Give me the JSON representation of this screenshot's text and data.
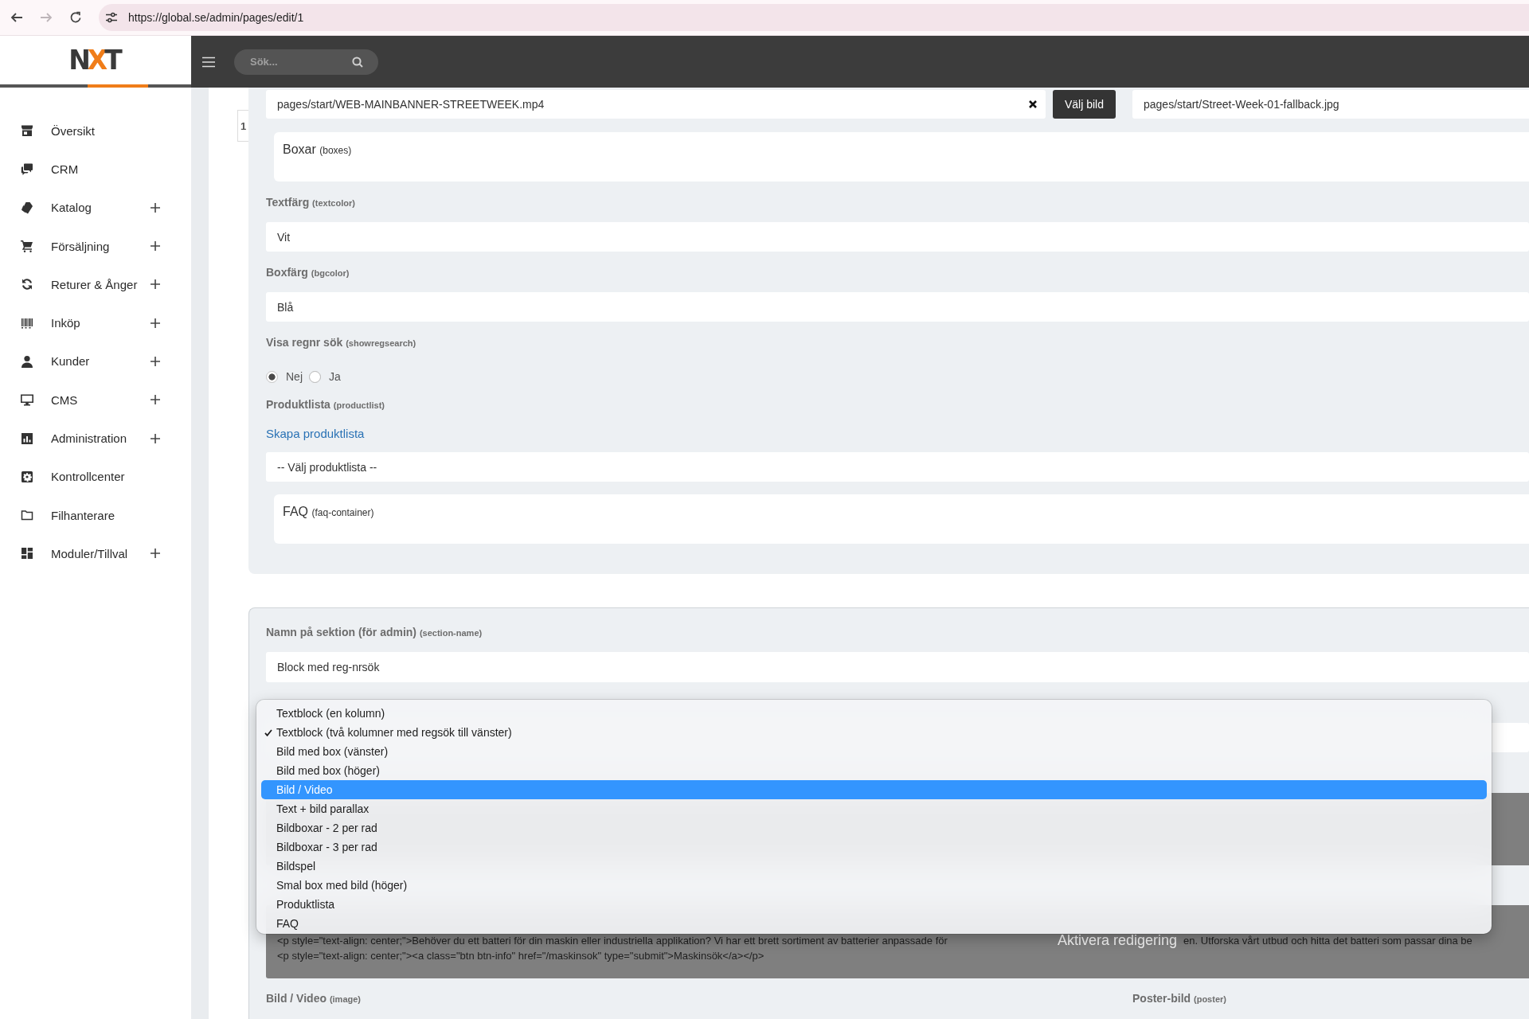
{
  "browser": {
    "url": "https://global.se/admin/pages/edit/1",
    "forward_disabled": true
  },
  "header": {
    "logo": "NXT",
    "search": {
      "placeholder": "Sök..."
    }
  },
  "sidebar": {
    "items": [
      {
        "label": "Översikt",
        "expandable": false
      },
      {
        "label": "CRM",
        "expandable": false
      },
      {
        "label": "Katalog",
        "expandable": true
      },
      {
        "label": "Försäljning",
        "expandable": true
      },
      {
        "label": "Returer & Ånger",
        "expandable": true
      },
      {
        "label": "Inköp",
        "expandable": true
      },
      {
        "label": "Kunder",
        "expandable": true
      },
      {
        "label": "CMS",
        "expandable": true
      },
      {
        "label": "Administration",
        "expandable": true
      },
      {
        "label": "Kontrollcenter",
        "expandable": false
      },
      {
        "label": "Filhanterare",
        "expandable": false
      },
      {
        "label": "Moduler/Tillval",
        "expandable": true
      }
    ]
  },
  "section_1": {
    "tab": "1",
    "video_field": {
      "value": "pages/start/WEB-MAINBANNER-STREETWEEK.mp4"
    },
    "choose_button": "Välj bild",
    "fallback_field": {
      "value": "pages/start/Street-Week-01-fallback.jpg"
    },
    "boxes_card": {
      "title": "Boxar",
      "key": "(boxes)"
    },
    "text_color": {
      "label": "Textfärg",
      "key": "(textcolor)",
      "value": "Vit"
    },
    "box_color": {
      "label": "Boxfärg",
      "key": "(bgcolor)",
      "value": "Blå"
    },
    "show_reg_search": {
      "label": "Visa regnr sök",
      "key": "(showregsearch)",
      "options": [
        {
          "label": "Nej",
          "selected": true
        },
        {
          "label": "Ja",
          "selected": false
        }
      ]
    },
    "product_list": {
      "label": "Produktlista",
      "key": "(productlist)",
      "link": "Skapa produktlista",
      "value": "-- Välj produktlista --"
    },
    "faq_card": {
      "title": "FAQ",
      "key": "(faq-container)"
    }
  },
  "section_2": {
    "name_field": {
      "label": "Namn på sektion (för admin)",
      "key": "(section-name)",
      "value": "Block med reg-nrsök"
    },
    "type_dropdown": {
      "options": [
        {
          "label": "Textblock (en kolumn)",
          "selected": false,
          "highlighted": false
        },
        {
          "label": "Textblock (två kolumner med regsök till vänster)",
          "selected": true,
          "highlighted": false
        },
        {
          "label": "Bild med box (vänster)",
          "selected": false,
          "highlighted": false
        },
        {
          "label": "Bild med box (höger)",
          "selected": false,
          "highlighted": false
        },
        {
          "label": "Bild / Video",
          "selected": false,
          "highlighted": true
        },
        {
          "label": "Text + bild parallax",
          "selected": false,
          "highlighted": false
        },
        {
          "label": "Bildboxar - 2 per rad",
          "selected": false,
          "highlighted": false
        },
        {
          "label": "Bildboxar - 3 per rad",
          "selected": false,
          "highlighted": false
        },
        {
          "label": "Bildspel",
          "selected": false,
          "highlighted": false
        },
        {
          "label": "Smal box med bild (höger)",
          "selected": false,
          "highlighted": false
        },
        {
          "label": "Produktlista",
          "selected": false,
          "highlighted": false
        },
        {
          "label": "FAQ",
          "selected": false,
          "highlighted": false
        }
      ]
    },
    "code_editor": {
      "line_1_start": "<p style=\"text-align: center;\">Behöver du ett batteri för din maskin eller industriella applikation? Vi har ett brett sortiment av batterier anpassade för",
      "overlay_label": "Aktivera redigering",
      "line_1_end": "en. Utforska vårt utbud och hitta det batteri som passar dina be",
      "line_2": "<p style=\"text-align: center;\"><a class=\"btn btn-info\" href=\"/maskinsok\" type=\"submit\">Maskinsök</a></p>"
    },
    "image_label": {
      "label": "Bild / Video",
      "key": "(image)"
    },
    "poster_label": {
      "label": "Poster-bild",
      "key": "(poster)"
    }
  }
}
